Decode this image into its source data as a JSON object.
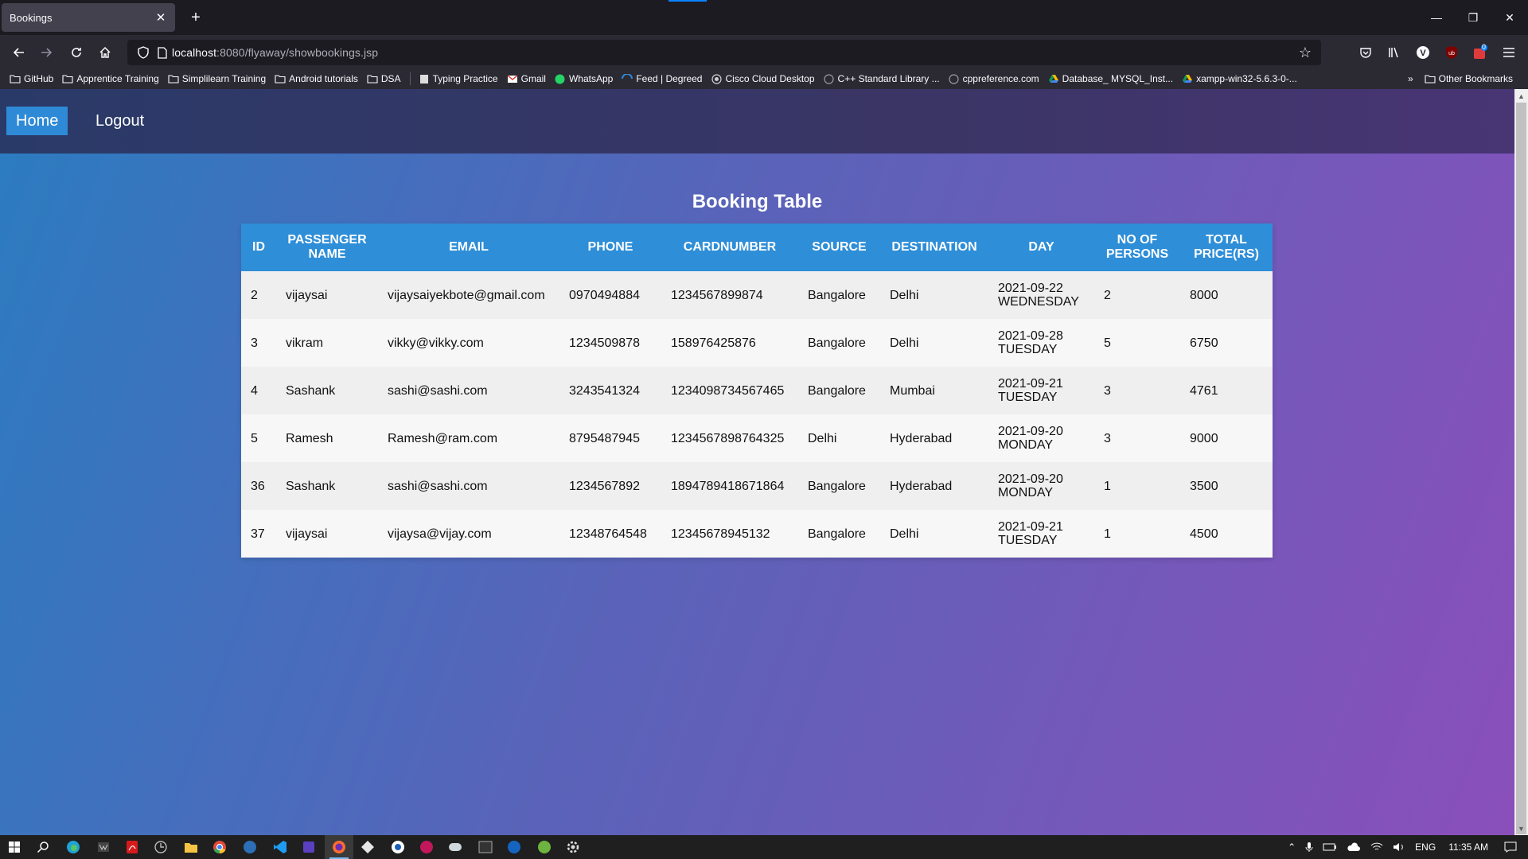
{
  "browser": {
    "tab_title": "Bookings",
    "tab_close": "✕",
    "new_tab": "+",
    "url_host": "localhost",
    "url_path": ":8080/flyaway/showbookings.jsp",
    "window_buttons": [
      "—",
      "❐",
      "✕"
    ]
  },
  "bookmarks": {
    "items": [
      {
        "label": "GitHub",
        "icon": "folder-icon"
      },
      {
        "label": "Apprentice Training",
        "icon": "folder-icon"
      },
      {
        "label": "Simplilearn Training",
        "icon": "folder-icon"
      },
      {
        "label": "Android tutorials",
        "icon": "folder-icon"
      },
      {
        "label": "DSA",
        "icon": "folder-icon"
      },
      {
        "label": "Typing Practice",
        "icon": "page-icon"
      },
      {
        "label": "Gmail",
        "icon": "gmail-icon"
      },
      {
        "label": "WhatsApp",
        "icon": "whatsapp-icon"
      },
      {
        "label": "Feed | Degreed",
        "icon": "degreed-icon"
      },
      {
        "label": "Cisco Cloud Desktop",
        "icon": "cisco-icon"
      },
      {
        "label": "C++ Standard Library ...",
        "icon": "cpp-icon"
      },
      {
        "label": "cppreference.com",
        "icon": "cpp-icon"
      },
      {
        "label": "Database_ MYSQL_Inst...",
        "icon": "drive-icon"
      },
      {
        "label": "xampp-win32-5.6.3-0-...",
        "icon": "drive-icon"
      }
    ],
    "overflow": "»",
    "other": "Other Bookmarks"
  },
  "nav": {
    "home": "Home",
    "logout": "Logout"
  },
  "table": {
    "title": "Booking Table",
    "headers": [
      "ID",
      "PASSENGER NAME",
      "EMAIL",
      "PHONE",
      "CARDNUMBER",
      "SOURCE",
      "DESTINATION",
      "DAY",
      "NO OF PERSONS",
      "TOTAL PRICE(RS)"
    ],
    "rows": [
      {
        "id": "2",
        "name": "vijaysai",
        "email": "vijaysaiyekbote@gmail.com",
        "phone": "0970494884",
        "card": "1234567899874",
        "source": "Bangalore",
        "destination": "Delhi",
        "date": "2021-09-22",
        "weekday": "WEDNESDAY",
        "persons": "2",
        "price": "8000"
      },
      {
        "id": "3",
        "name": "vikram",
        "email": "vikky@vikky.com",
        "phone": "1234509878",
        "card": "158976425876",
        "source": "Bangalore",
        "destination": "Delhi",
        "date": "2021-09-28",
        "weekday": "TUESDAY",
        "persons": "5",
        "price": "6750"
      },
      {
        "id": "4",
        "name": "Sashank",
        "email": "sashi@sashi.com",
        "phone": "3243541324",
        "card": "1234098734567465",
        "source": "Bangalore",
        "destination": "Mumbai",
        "date": "2021-09-21",
        "weekday": "TUESDAY",
        "persons": "3",
        "price": "4761"
      },
      {
        "id": "5",
        "name": "Ramesh",
        "email": "Ramesh@ram.com",
        "phone": "8795487945",
        "card": "1234567898764325",
        "source": "Delhi",
        "destination": "Hyderabad",
        "date": "2021-09-20",
        "weekday": "MONDAY",
        "persons": "3",
        "price": "9000"
      },
      {
        "id": "36",
        "name": "Sashank",
        "email": "sashi@sashi.com",
        "phone": "1234567892",
        "card": "1894789418671864",
        "source": "Bangalore",
        "destination": "Hyderabad",
        "date": "2021-09-20",
        "weekday": "MONDAY",
        "persons": "1",
        "price": "3500"
      },
      {
        "id": "37",
        "name": "vijaysai",
        "email": "vijaysa@vijay.com",
        "phone": "12348764548",
        "card": "12345678945132",
        "source": "Bangalore",
        "destination": "Delhi",
        "date": "2021-09-21",
        "weekday": "TUESDAY",
        "persons": "1",
        "price": "4500"
      }
    ]
  },
  "taskbar": {
    "language": "ENG",
    "time": "11:35 AM",
    "badge_count": "0"
  },
  "colors": {
    "header_blue": "#2e8ed8",
    "home_button": "#2e8ad6",
    "gradient_start": "#2b7cc1",
    "gradient_end": "#8a4fba"
  }
}
